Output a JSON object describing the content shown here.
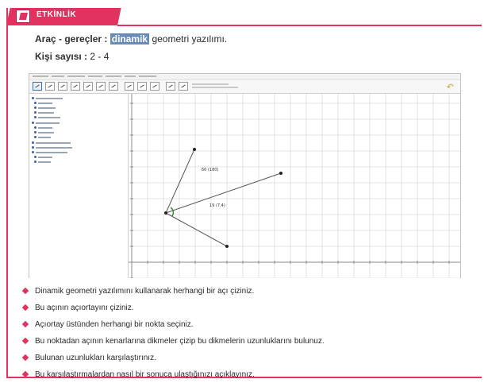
{
  "header": {
    "label": "ETKİNLİK"
  },
  "materials": {
    "label": "Araç - gereçler :",
    "highlight": "dinamik",
    "text": "geometri yazılımı."
  },
  "people": {
    "label": "Kişi sayısı :",
    "value": "2 - 4"
  },
  "software": {
    "icon": "geometry-software-window",
    "plot_labels": [
      "60 (180)",
      "19 (7,4)"
    ]
  },
  "instructions": [
    "Dinamik geometri yazılımını kullanarak herhangi bir açı çiziniz.",
    "Bu açının açıortayını çiziniz.",
    "Açıortay üstünden herhangi bir nokta seçiniz.",
    "Bu noktadan açının kenarlarına dikmeler çizip bu dikmelerin uzunluklarını bulunuz.",
    "Bulunan uzunlukları karşılaştırınız.",
    "Bu karşılaştırmalardan nasıl bir sonuca ulaştığınızı açıklayınız."
  ],
  "colors": {
    "accent": "#e2325f",
    "highlight": "#6a8bb8"
  }
}
